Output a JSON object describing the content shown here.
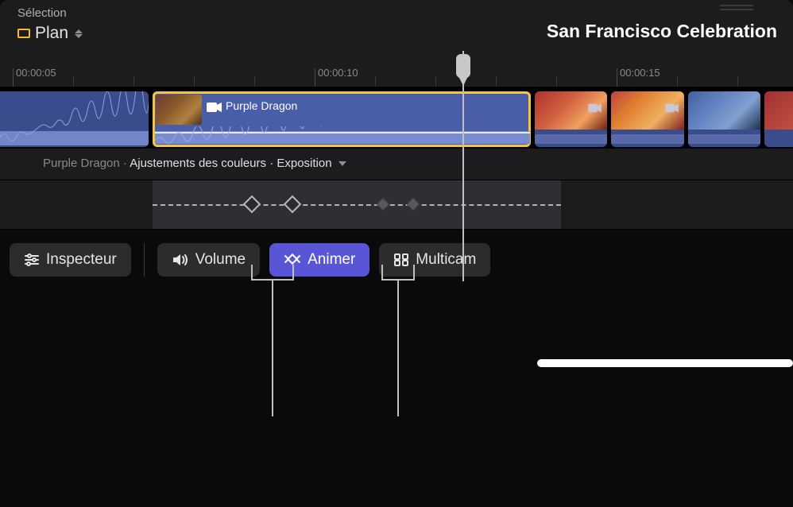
{
  "header": {
    "selection_label": "Sélection",
    "plan_label": "Plan",
    "project_title": "San Francisco Celebration"
  },
  "ruler": {
    "t1": "00:00:05",
    "t2": "00:00:10",
    "t3": "00:00:15"
  },
  "clips": {
    "selected_label": "Purple Dragon"
  },
  "param": {
    "clip_name": "Purple Dragon",
    "effect": "Ajustements des couleurs",
    "property": "Exposition"
  },
  "toolbar": {
    "inspector": "Inspecteur",
    "volume": "Volume",
    "animate": "Animer",
    "multicam": "Multicam"
  },
  "icons": {
    "camera": "camera",
    "sliders": "sliders",
    "speaker": "speaker",
    "keyframe": "keyframe",
    "grid": "grid"
  }
}
